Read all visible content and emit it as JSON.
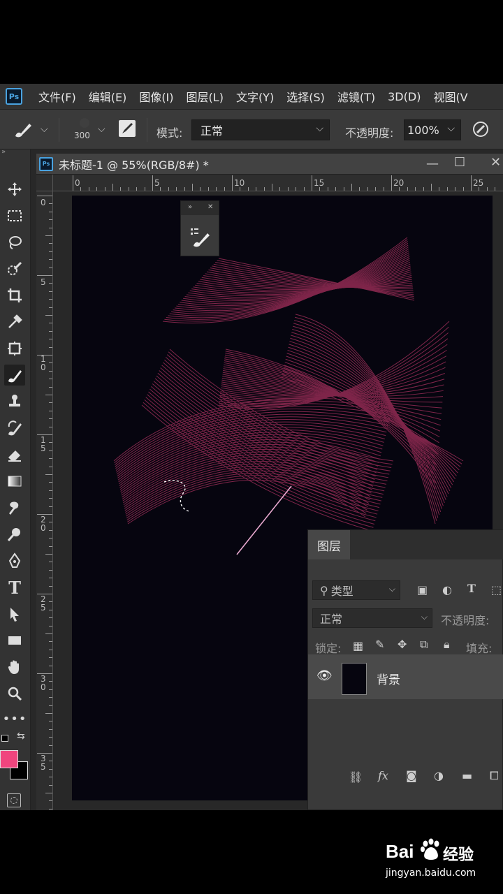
{
  "menu": {
    "items": [
      "文件(F)",
      "编辑(E)",
      "图像(I)",
      "图层(L)",
      "文字(Y)",
      "选择(S)",
      "滤镜(T)",
      "3D(D)",
      "视图(V"
    ]
  },
  "options": {
    "brush_size": "300",
    "mode_label": "模式:",
    "mode_value": "正常",
    "opacity_label": "不透明度:",
    "opacity_value": "100%"
  },
  "document": {
    "title": "未标题-1 @ 55%(RGB/8#) *",
    "ruler_h": [
      "0",
      "5",
      "10",
      "15",
      "20",
      "25"
    ],
    "ruler_v": [
      "0",
      "5",
      "1\n0",
      "1\n5",
      "2\n0",
      "2\n5",
      "3\n0",
      "3\n5"
    ]
  },
  "layers": {
    "tab_label": "图层",
    "filter_placeholder": "类型",
    "blend_mode": "正常",
    "opacity_label": "不透明度:",
    "lock_label": "锁定:",
    "fill_label": "填充:",
    "layer_name": "背景"
  },
  "colors": {
    "foreground": "#f0457e",
    "background": "#000000",
    "accent": "#4aa3e0",
    "strands": "#e0407a"
  },
  "watermark": {
    "brand": "Bai",
    "brand_cn": "经验",
    "url": "jingyan.baidu.com"
  }
}
